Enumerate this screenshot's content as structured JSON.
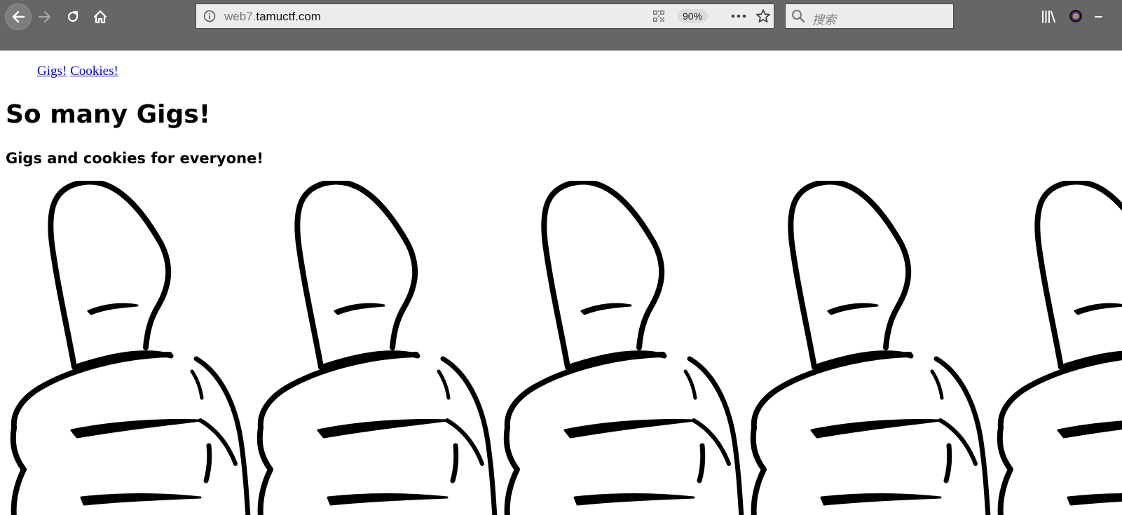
{
  "browser": {
    "address_prefix": "web7.",
    "address_domain": "tamuctf.com",
    "zoom_level": "90%",
    "search_placeholder": "搜索",
    "icons": [
      "back-arrow-icon",
      "forward-arrow-icon",
      "reload-icon",
      "home-icon",
      "info-icon",
      "qr-code-icon",
      "more-dots-icon",
      "bookmark-star-icon",
      "search-icon",
      "library-icon",
      "extension-icon",
      "overflow-icon"
    ]
  },
  "page": {
    "nav_links": [
      "Gigs!",
      "Cookies!"
    ],
    "title": "So many Gigs!",
    "subtitle": "Gigs and cookies for everyone!",
    "image_count_visible": 5,
    "image_icon": "thumbs-up-icon"
  },
  "colors": {
    "toolbar_bg": "#666666",
    "link_color": "#0000ee",
    "page_bg": "#ffffff"
  }
}
